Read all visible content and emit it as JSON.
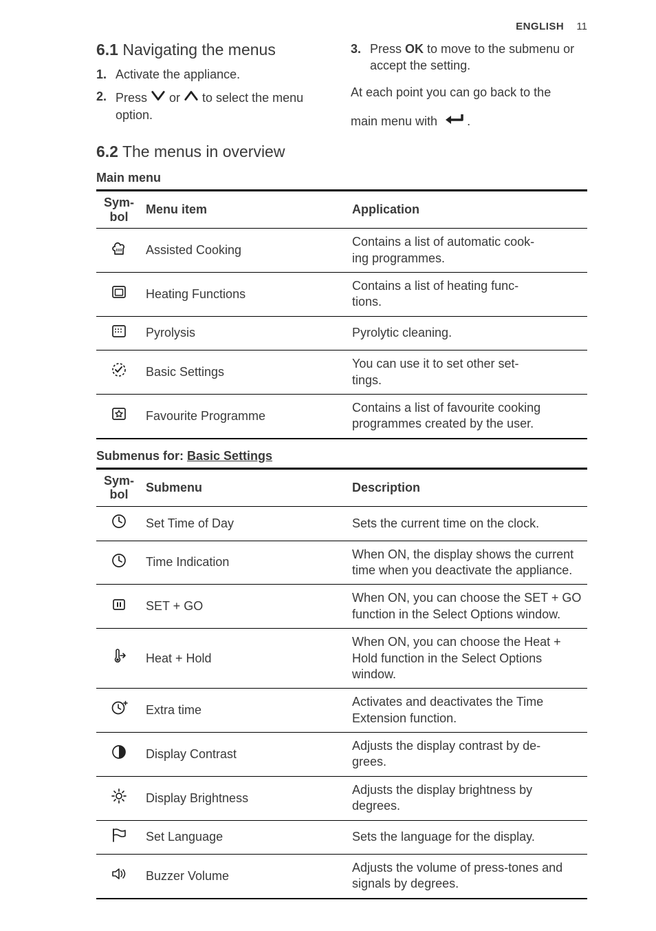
{
  "header": {
    "lang": "ENGLISH",
    "page": "11"
  },
  "section61": {
    "title_num": "6.1",
    "title_rest": " Navigating the menus",
    "steps": [
      {
        "n": "1.",
        "text": "Activate the appliance."
      },
      {
        "n": "2.",
        "pre": "Press ",
        "mid": " or ",
        "post": " to select the menu option."
      },
      {
        "n": "3.",
        "pre": "Press ",
        "ok": "OK",
        "post": " to move to the submenu or accept the setting."
      }
    ],
    "tail_pre": "At each point you can go back to the",
    "tail_post_a": "main menu with ",
    "tail_post_b": "."
  },
  "section62": {
    "title_num": "6.2",
    "title_rest": " The menus in overview",
    "main_label": "Main menu",
    "main_headers": {
      "sym": "Sym-\nbol",
      "item": "Menu item",
      "app": "Application"
    },
    "main_rows": [
      {
        "icon": "chef-hat-icon",
        "item": "Assisted Cooking",
        "app": "Contains a list of automatic cook-\ning programmes."
      },
      {
        "icon": "oven-box-icon",
        "item": "Heating Functions",
        "app": "Contains a list of heating func-\ntions."
      },
      {
        "icon": "grid-box-icon",
        "item": "Pyrolysis",
        "app": "Pyrolytic cleaning."
      },
      {
        "icon": "check-gear-icon",
        "item": "Basic Settings",
        "app": "You can use it to set other set-\ntings."
      },
      {
        "icon": "star-box-icon",
        "item": "Favourite Programme",
        "app": "Contains a list of favourite cooking programmes created by the user."
      }
    ],
    "sub_label_pre": "Submenus for: ",
    "sub_label_link": "Basic Settings",
    "sub_headers": {
      "sym": "Sym-\nbol",
      "item": "Submenu",
      "desc": "Description"
    },
    "sub_rows": [
      {
        "icon": "clock-tick-icon",
        "item": "Set Time of Day",
        "desc": "Sets the current time on the clock."
      },
      {
        "icon": "clock-tick-icon",
        "item": "Time Indication",
        "desc": "When ON, the display shows the current time when you deactivate the appliance."
      },
      {
        "icon": "pause-box-icon",
        "item": "SET + GO",
        "desc": "When ON, you can choose the SET + GO function in the Select Options window."
      },
      {
        "icon": "thermo-arrow-icon",
        "item": "Heat + Hold",
        "desc": "When ON, you can choose the Heat + Hold function in the Select Options window."
      },
      {
        "icon": "clock-plus-icon",
        "item": "Extra time",
        "desc": "Activates and deactivates the Time Extension function."
      },
      {
        "icon": "contrast-icon",
        "item": "Display Contrast",
        "desc": "Adjusts the display contrast by de-\ngrees."
      },
      {
        "icon": "brightness-icon",
        "item": "Display Brightness",
        "desc": "Adjusts the display brightness by degrees."
      },
      {
        "icon": "flag-icon",
        "item": "Set Language",
        "desc": "Sets the language for the display."
      },
      {
        "icon": "speaker-icon",
        "item": "Buzzer Volume",
        "desc": "Adjusts the volume of press-tones and signals by degrees."
      }
    ]
  }
}
